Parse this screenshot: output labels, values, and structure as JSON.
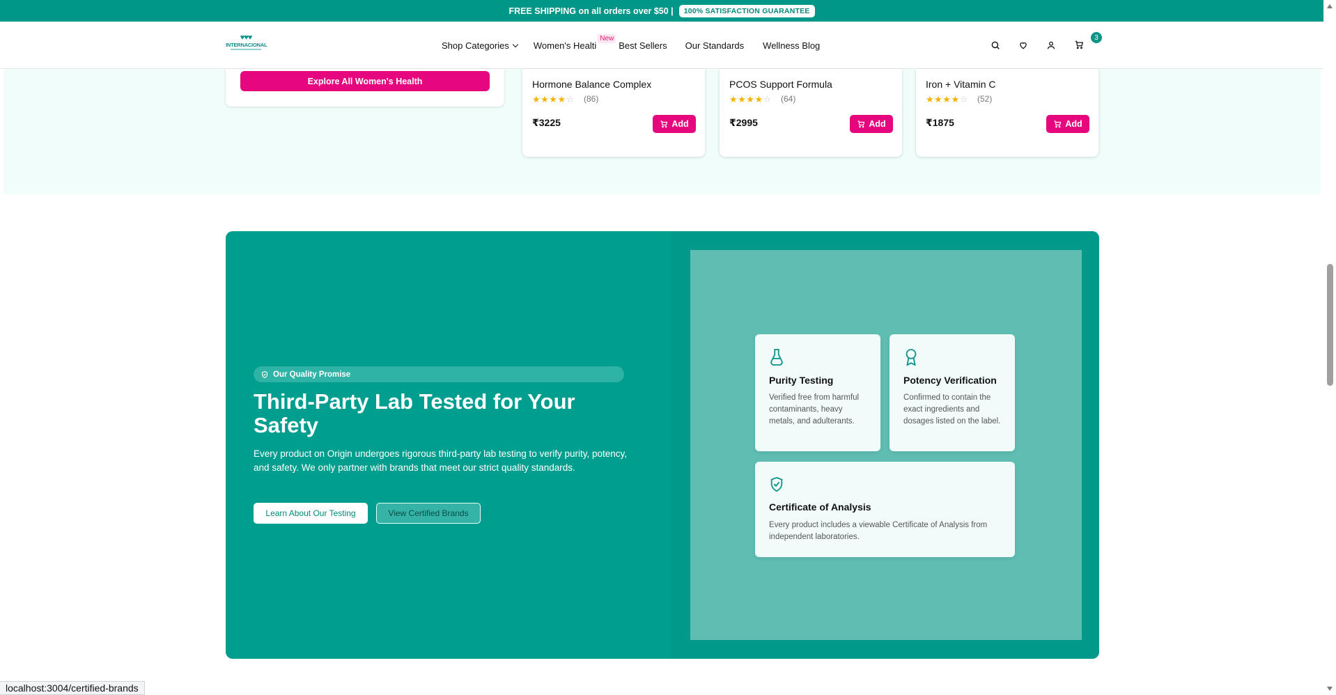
{
  "topbar": {
    "shipping_text": "FREE SHIPPING on all orders over $50 |",
    "guarantee": "100% SATISFACTION GUARANTEE"
  },
  "header": {
    "logo_text": "INTERNACIONAL",
    "nav": [
      {
        "label": "Shop Categories"
      },
      {
        "label": "Women's Healti",
        "badge": "New"
      },
      {
        "label": "Best Sellers"
      },
      {
        "label": "Our Standards"
      },
      {
        "label": "Wellness Blog"
      }
    ],
    "cart_count": "3"
  },
  "explore": {
    "label": "Explore All Women's Health"
  },
  "products": [
    {
      "name": "Hormone Balance Complex",
      "reviews": "(86)",
      "price": "₹3225",
      "add": "Add",
      "rating": 4
    },
    {
      "name": "PCOS Support Formula",
      "reviews": "(64)",
      "price": "₹2995",
      "add": "Add",
      "rating": 4
    },
    {
      "name": "Iron + Vitamin C",
      "reviews": "(52)",
      "price": "₹1875",
      "add": "Add",
      "rating": 4
    }
  ],
  "quality": {
    "pill": "Our Quality Promise",
    "title": "Third-Party Lab Tested for Your Safety",
    "description": "Every product on Origin undergoes rigorous third-party lab testing to verify purity, potency, and safety. We only partner with brands that meet our strict quality standards.",
    "learn_btn": "Learn About Our Testing",
    "brands_btn": "View Certified Brands",
    "features": [
      {
        "title": "Purity Testing",
        "desc": "Verified free from harmful contaminants, heavy metals, and adulterants."
      },
      {
        "title": "Potency Verification",
        "desc": "Confirmed to contain the exact ingredients and dosages listed on the label."
      },
      {
        "title": "Certificate of Analysis",
        "desc": "Every product includes a viewable Certificate of Analysis from independent laboratories."
      }
    ]
  },
  "status_url": "localhost:3004/certified-brands",
  "colors": {
    "teal": "#009688",
    "pink": "#e6077e",
    "mint": "#f0fdfa"
  }
}
